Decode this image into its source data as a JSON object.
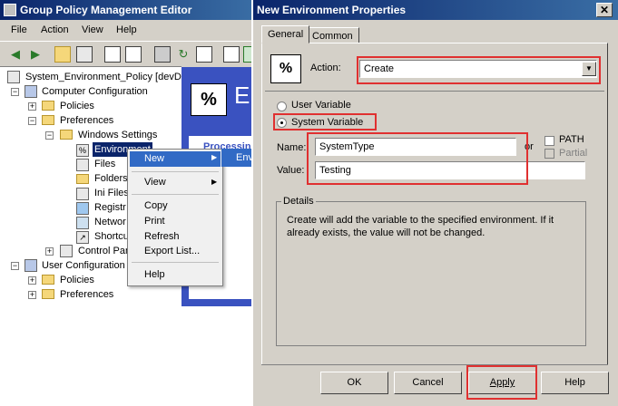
{
  "gpme": {
    "title": "Group Policy Management Editor",
    "menu": [
      "File",
      "Action",
      "View",
      "Help"
    ],
    "tree": {
      "root": "System_Environment_Policy [devD",
      "computer_configuration": "Computer Configuration",
      "policies": "Policies",
      "preferences": "Preferences",
      "windows_settings": "Windows Settings",
      "environment": "Environment",
      "files": "Files",
      "folders": "Folders",
      "ini_files": "Ini Files",
      "registry": "Registr",
      "network_shares": "Networ",
      "shortcuts": "Shortcu",
      "control_panel": "Control Pan",
      "user_configuration": "User Configuration",
      "user_policies": "Policies",
      "user_preferences": "Preferences"
    },
    "right_pane": {
      "title": "E",
      "processing": "Processin"
    }
  },
  "context_menu": {
    "new": "New",
    "view": "View",
    "copy": "Copy",
    "print": "Print",
    "refresh": "Refresh",
    "export_list": "Export List...",
    "help": "Help",
    "submenu_item": "Env"
  },
  "dialog": {
    "title": "New Environment Properties",
    "close": "✕",
    "tabs": [
      "General",
      "Common"
    ],
    "icon_text": "%",
    "action_label": "Action:",
    "action_value": "Create",
    "user_variable": "User Variable",
    "system_variable": "System Variable",
    "name_label": "Name:",
    "name_value": "SystemType",
    "or_label": "or",
    "path_label": "PATH",
    "partial_label": "Partial",
    "value_label": "Value:",
    "value_value": "Testing",
    "details_label": "Details",
    "details_text": "Create will add the variable to the specified environment. If it already exists, the value will not be changed.",
    "buttons": {
      "ok": "OK",
      "cancel": "Cancel",
      "apply": "Apply",
      "help": "Help"
    }
  },
  "colors": {
    "titlebar": "#0a246a",
    "highlight": "#e03030",
    "panel": "#d4d0c8"
  }
}
